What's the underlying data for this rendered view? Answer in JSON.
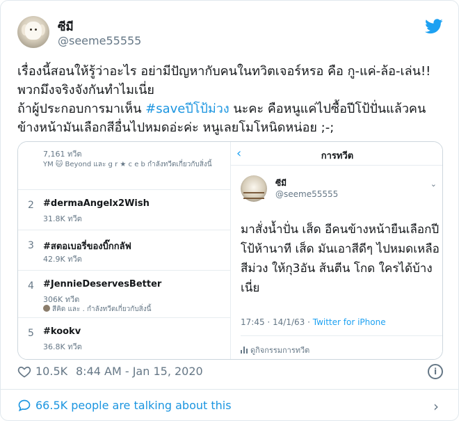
{
  "author": {
    "name": "ซีมี",
    "handle": "@seeme55555"
  },
  "tweet": {
    "line1": "เรื่องนี้สอนให้รู้ว่าอะไร อย่ามีปัญหากับคนในทวิตเจอร์หรอ คือ กู-แค่-ล้อ-เล่น!!",
    "line2": "พวกมึงจริงจังกันทำไมเนี่ย",
    "line3_pre": "ถ้าผู้ประกอบการมาเห็น ",
    "hashtag": "#saveปีโป้ม่วง",
    "line3_post": " นะคะ คือหนูแค่ไปซื้อปีโป้ปั่นแล้วคน",
    "line4": "ข้างหน้ามันเลือกสีอื่นไปหมดอ่ะค่ะ หนูเลยโมโหนิดหน่อย ;-;"
  },
  "trends": {
    "top_count": "7,161 ทวีต",
    "top_sub": "YM 🐱 Beyond และ g r ★ c e b กำลังทวีตเกี่ยวกับสิ่งนี้",
    "items": [
      {
        "rank": "2",
        "name": "#dermaAngelx2Wish",
        "count": "31.8K ทวีต",
        "sub": ""
      },
      {
        "rank": "3",
        "name": "#สตอเบอรี่ของบิ๊กกลัฟ",
        "count": "42.9K ทวีต",
        "sub": ""
      },
      {
        "rank": "4",
        "name": "#JennieDeservesBetter",
        "count": "306K ทวีต",
        "sub": "สีคิด และ . กำลังทวีตเกี่ยวกับสิ่งนี้"
      },
      {
        "rank": "5",
        "name": "#kookv",
        "count": "36.8K ทวีต",
        "sub": ""
      }
    ]
  },
  "embedded": {
    "back": "‹",
    "title": "การทวีต",
    "name": "ซีมี",
    "handle": "@seeme55555",
    "text": "มาสั่งน้ำปั่น เส็ด อีคนข้างหน้ายืนเลือกปีโป้ห้านาที เส็ด มันเอาสีดีๆ ไปหมดเหลือสีม่วง ให้กุ3อัน ส้นตีน โกด ใครได้บ้างเนี่ย",
    "time": "17:45 · 14/1/63 · ",
    "source": "Twitter for iPhone",
    "activity": "ดูกิจกรรมการทวีต"
  },
  "stats": {
    "likes": "10.5K",
    "timestamp": "8:44 AM - Jan 15, 2020",
    "info": "i"
  },
  "footer": {
    "talking": "66.5K people are talking about this",
    "chevron": "›"
  },
  "colors": {
    "accent": "#1b95e0",
    "twitter_blue": "#1da1f2",
    "muted": "#657786",
    "border": "#e1e8ed"
  },
  "icons": [
    "twitter-bird-icon",
    "heart-icon",
    "info-icon",
    "speech-bubble-icon",
    "chevron-right-icon",
    "back-chevron-icon",
    "chevron-down-icon",
    "bar-chart-icon"
  ]
}
